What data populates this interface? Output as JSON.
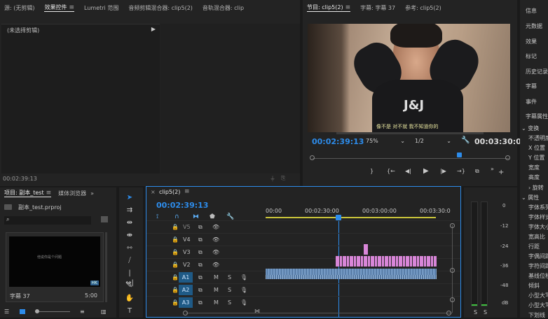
{
  "source_panel": {
    "tabs": [
      {
        "label": "源: (无剪辑)",
        "active": false
      },
      {
        "label": "效果控件",
        "active": true
      },
      {
        "label": "Lumetri 范围",
        "active": false
      },
      {
        "label": "音频剪辑混合器: clip5(2)",
        "active": false
      },
      {
        "label": "音轨混合器: clip",
        "active": false
      }
    ],
    "no_clip_selected": "(未选择剪辑)",
    "timecode": "00:02:39:13"
  },
  "program_monitor": {
    "tabs": [
      {
        "label": "节目: clip5(2)",
        "active": true
      },
      {
        "label": "字幕: 字幕 37",
        "active": false
      },
      {
        "label": "参考: clip5(2)",
        "active": false
      }
    ],
    "video_text": "J&J",
    "subtitle": "像不是 对不就 我不知道你的",
    "timecode": "00:02:39:13",
    "zoom": "75%",
    "resolution": "1/2",
    "duration": "00:03:30:0",
    "controls": [
      "}",
      "{←",
      "◀|",
      "▶",
      "|▶",
      "→}",
      "⧉",
      "»",
      "+"
    ]
  },
  "project_panel": {
    "tabs": [
      {
        "label": "项目: 副本_test",
        "active": true
      },
      {
        "label": "媒体浏览器",
        "active": false
      }
    ],
    "file_name": "副本_test.prproj",
    "thumb_overlay": "他说你是个问题",
    "thumb_badge": "HK",
    "item_label": "字幕 37",
    "item_duration": "5:00"
  },
  "timeline": {
    "tab": "clip5(2)",
    "timecode": "00:02:39:13",
    "ruler": [
      "00:00",
      "00:02:30:00",
      "00:03:00:00",
      "00:03:30:0"
    ],
    "video_tracks": [
      "V5",
      "V4",
      "V3",
      "V2"
    ],
    "audio_tracks": [
      "A1",
      "A2",
      "A3"
    ],
    "mute_label": "M",
    "solo_label": "S"
  },
  "audio_meter": {
    "scale": [
      "0",
      "-12",
      "-24",
      "-36",
      "-48",
      "dB"
    ],
    "solo": [
      "S",
      "S"
    ]
  },
  "right_sidebar": {
    "items": [
      "信息",
      "元数据",
      "效果",
      "标记",
      "历史记录",
      "字幕",
      "事件",
      "字幕属性"
    ],
    "props_group": "变换",
    "props": [
      "不透明度",
      "X 位置",
      "Y 位置",
      "宽度",
      "高度"
    ],
    "rotate": "旋转",
    "attr_group": "属性",
    "attrs": [
      "字体系列",
      "字体样式",
      "字体大小",
      "宽高比",
      "行距",
      "字偶间距",
      "字符间距",
      "基线位移",
      "倾斜",
      "小型大写",
      "小型大写",
      "下划线"
    ]
  }
}
